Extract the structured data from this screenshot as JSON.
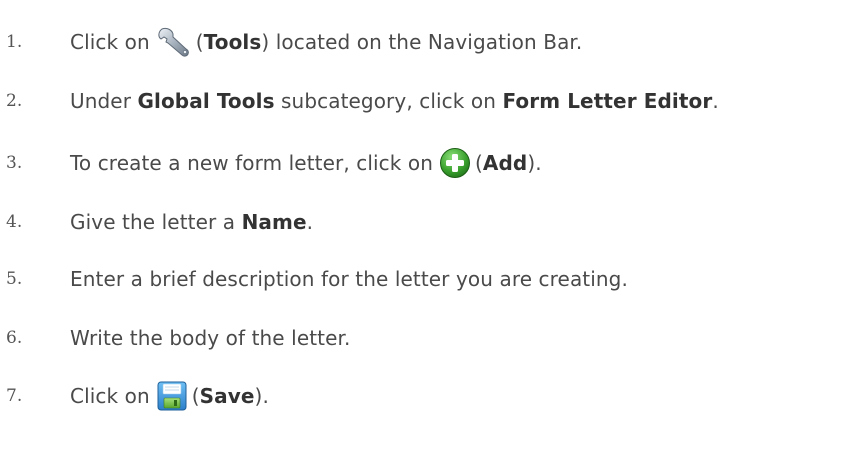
{
  "steps": [
    {
      "number": "1.",
      "pre": "Click on",
      "icon": "wrench-icon",
      "paren_open": "(",
      "bold": "Tools",
      "post": ") located on the Navigation Bar."
    },
    {
      "number": "2.",
      "pre": "Under ",
      "bold1": "Global Tools",
      "mid": " subcategory, click on ",
      "bold2": "Form Letter Editor",
      "post": "."
    },
    {
      "number": "3.",
      "pre": "To create a new form letter, click on",
      "icon": "add-icon",
      "paren_open": "(",
      "bold": "Add",
      "post": ")."
    },
    {
      "number": "4.",
      "pre": "Give the letter a ",
      "bold": "Name",
      "post": "."
    },
    {
      "number": "5.",
      "text": "Enter a brief description for the letter you are creating."
    },
    {
      "number": "6.",
      "text": "Write the body of the letter."
    },
    {
      "number": "7.",
      "pre": "Click on",
      "icon": "save-icon",
      "paren_open": "(",
      "bold": "Save",
      "post": ")."
    }
  ],
  "colors": {
    "text": "#4a4a4a",
    "add_green": "#3aa12e",
    "save_blue": "#3b9be0",
    "save_green": "#7cc242"
  }
}
